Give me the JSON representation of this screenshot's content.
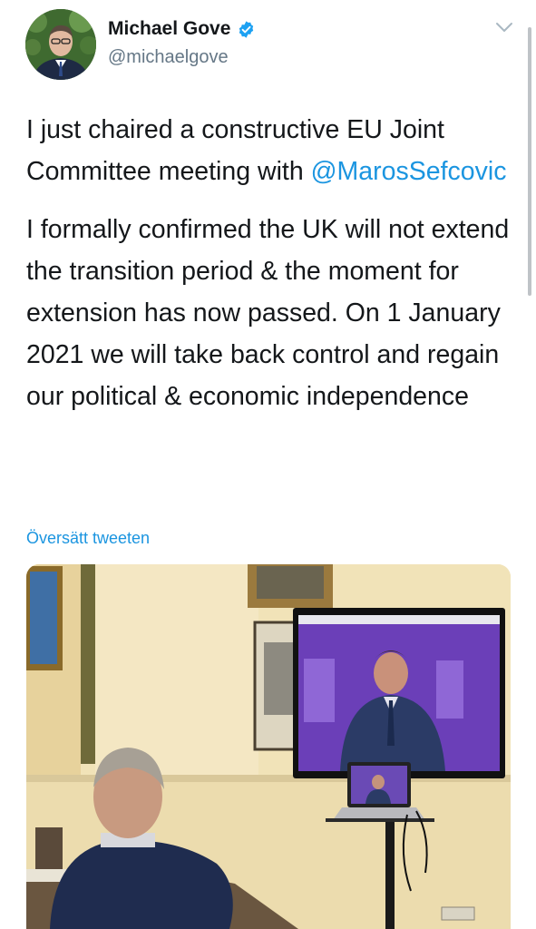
{
  "tweet": {
    "author_name": "Michael Gove",
    "author_handle": "@michaelgove",
    "text_line1": "I just chaired a constructive EU Joint Committee meeting with ",
    "mention": "@MarosSefcovic",
    "text_paragraph2": "I formally confirmed the UK will not extend the transition period & the moment for extension has now passed. On 1 January 2021 we will take back control and regain our political & economic independence",
    "translate_label": "Översätt tweeten"
  },
  "icons": {
    "verified": "verified-badge-icon",
    "more": "chevron-down-icon"
  },
  "colors": {
    "link": "#1b95e0",
    "verified": "#1da1f2",
    "handle": "#657786",
    "text": "#14171a"
  }
}
